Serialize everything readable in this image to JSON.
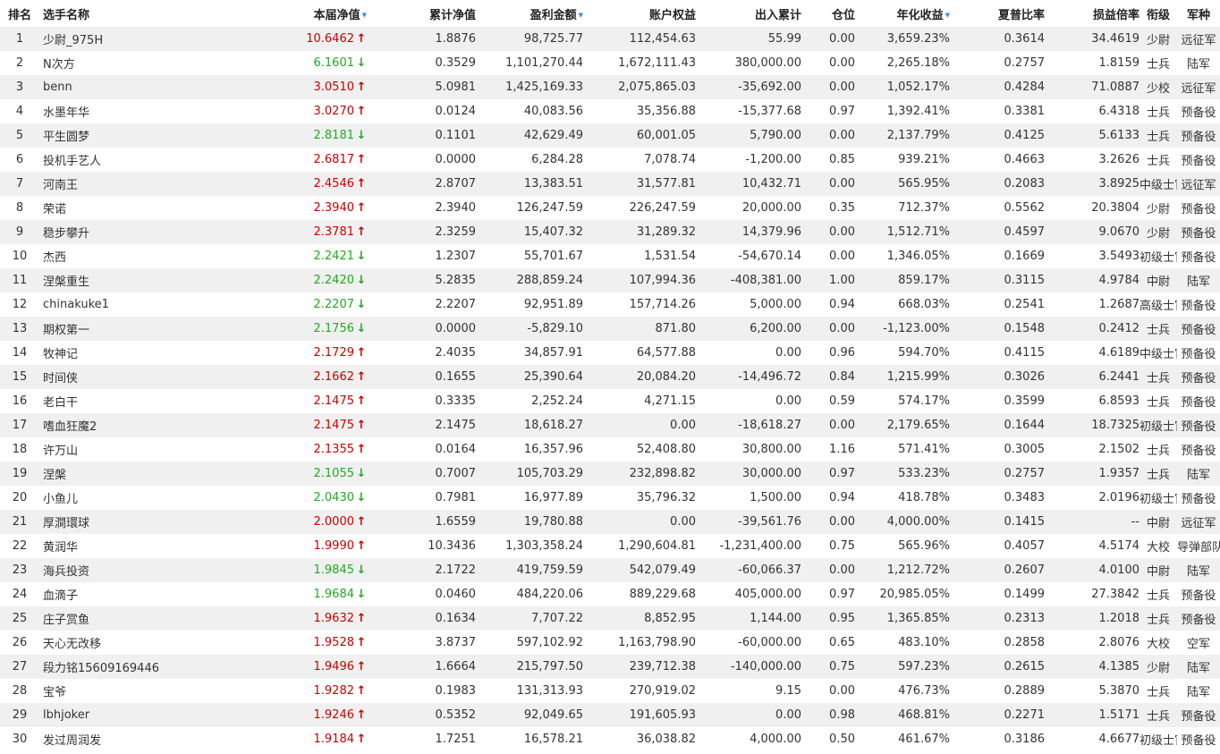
{
  "colors": {
    "up": "#cc0000",
    "down": "#22aa22",
    "sort_indicator": "#3a8fd6",
    "stripe": "#f0f0f0"
  },
  "headers": {
    "rank": "排名",
    "name": "选手名称",
    "nav": "本届净值",
    "cum_nav": "累计净值",
    "profit": "盈利金额",
    "equity": "账户权益",
    "flow": "出入累计",
    "position": "仓位",
    "annual": "年化收益",
    "sharpe": "夏普比率",
    "pl_ratio": "损益倍率",
    "rank_title": "衔级",
    "branch": "军种"
  },
  "rows": [
    {
      "rank": "1",
      "name": "少尉_975H",
      "nav": "10.6462",
      "dir": "up",
      "cum_nav": "1.8876",
      "profit": "98,725.77",
      "equity": "112,454.63",
      "flow": "55.99",
      "position": "0.00",
      "annual": "3,659.23%",
      "sharpe": "0.3614",
      "pl_ratio": "34.4619",
      "rank_title": "少尉",
      "branch": "远征军"
    },
    {
      "rank": "2",
      "name": "N次方",
      "nav": "6.1601",
      "dir": "down",
      "cum_nav": "0.3529",
      "profit": "1,101,270.44",
      "equity": "1,672,111.43",
      "flow": "380,000.00",
      "position": "0.00",
      "annual": "2,265.18%",
      "sharpe": "0.2757",
      "pl_ratio": "1.8159",
      "rank_title": "士兵",
      "branch": "陆军"
    },
    {
      "rank": "3",
      "name": "benn",
      "nav": "3.0510",
      "dir": "up",
      "cum_nav": "5.0981",
      "profit": "1,425,169.33",
      "equity": "2,075,865.03",
      "flow": "-35,692.00",
      "position": "0.00",
      "annual": "1,052.17%",
      "sharpe": "0.4284",
      "pl_ratio": "71.0887",
      "rank_title": "少校",
      "branch": "远征军"
    },
    {
      "rank": "4",
      "name": "水墨年华",
      "nav": "3.0270",
      "dir": "up",
      "cum_nav": "0.0124",
      "profit": "40,083.56",
      "equity": "35,356.88",
      "flow": "-15,377.68",
      "position": "0.97",
      "annual": "1,392.41%",
      "sharpe": "0.3381",
      "pl_ratio": "6.4318",
      "rank_title": "士兵",
      "branch": "预备役"
    },
    {
      "rank": "5",
      "name": "平生圆梦",
      "nav": "2.8181",
      "dir": "down",
      "cum_nav": "0.1101",
      "profit": "42,629.49",
      "equity": "60,001.05",
      "flow": "5,790.00",
      "position": "0.00",
      "annual": "2,137.79%",
      "sharpe": "0.4125",
      "pl_ratio": "5.6133",
      "rank_title": "士兵",
      "branch": "预备役"
    },
    {
      "rank": "6",
      "name": "投机手艺人",
      "nav": "2.6817",
      "dir": "up",
      "cum_nav": "0.0000",
      "profit": "6,284.28",
      "equity": "7,078.74",
      "flow": "-1,200.00",
      "position": "0.85",
      "annual": "939.21%",
      "sharpe": "0.4663",
      "pl_ratio": "3.2626",
      "rank_title": "士兵",
      "branch": "预备役"
    },
    {
      "rank": "7",
      "name": "河南王",
      "nav": "2.4546",
      "dir": "up",
      "cum_nav": "2.8707",
      "profit": "13,383.51",
      "equity": "31,577.81",
      "flow": "10,432.71",
      "position": "0.00",
      "annual": "565.95%",
      "sharpe": "0.2083",
      "pl_ratio": "3.8925",
      "rank_title": "中级士官",
      "branch": "远征军"
    },
    {
      "rank": "8",
      "name": "荣诺",
      "nav": "2.3940",
      "dir": "up",
      "cum_nav": "2.3940",
      "profit": "126,247.59",
      "equity": "226,247.59",
      "flow": "20,000.00",
      "position": "0.35",
      "annual": "712.37%",
      "sharpe": "0.5562",
      "pl_ratio": "20.3804",
      "rank_title": "少尉",
      "branch": "预备役"
    },
    {
      "rank": "9",
      "name": "稳步攀升",
      "nav": "2.3781",
      "dir": "up",
      "cum_nav": "2.3259",
      "profit": "15,407.32",
      "equity": "31,289.32",
      "flow": "14,379.96",
      "position": "0.00",
      "annual": "1,512.71%",
      "sharpe": "0.4597",
      "pl_ratio": "9.0670",
      "rank_title": "少尉",
      "branch": "预备役"
    },
    {
      "rank": "10",
      "name": "杰西",
      "nav": "2.2421",
      "dir": "down",
      "cum_nav": "1.2307",
      "profit": "55,701.67",
      "equity": "1,531.54",
      "flow": "-54,670.14",
      "position": "0.00",
      "annual": "1,346.05%",
      "sharpe": "0.1669",
      "pl_ratio": "3.5493",
      "rank_title": "初级士官",
      "branch": "预备役"
    },
    {
      "rank": "11",
      "name": "涅槃重生",
      "nav": "2.2420",
      "dir": "down",
      "cum_nav": "5.2835",
      "profit": "288,859.24",
      "equity": "107,994.36",
      "flow": "-408,381.00",
      "position": "1.00",
      "annual": "859.17%",
      "sharpe": "0.3115",
      "pl_ratio": "4.9784",
      "rank_title": "中尉",
      "branch": "陆军"
    },
    {
      "rank": "12",
      "name": "chinakuke1",
      "nav": "2.2207",
      "dir": "down",
      "cum_nav": "2.2207",
      "profit": "92,951.89",
      "equity": "157,714.26",
      "flow": "5,000.00",
      "position": "0.94",
      "annual": "668.03%",
      "sharpe": "0.2541",
      "pl_ratio": "1.2687",
      "rank_title": "高级士官",
      "branch": "预备役"
    },
    {
      "rank": "13",
      "name": "期权第一",
      "nav": "2.1756",
      "dir": "down",
      "cum_nav": "0.0000",
      "profit": "-5,829.10",
      "equity": "871.80",
      "flow": "6,200.00",
      "position": "0.00",
      "annual": "-1,123.00%",
      "sharpe": "0.1548",
      "pl_ratio": "0.2412",
      "rank_title": "士兵",
      "branch": "预备役"
    },
    {
      "rank": "14",
      "name": "牧神记",
      "nav": "2.1729",
      "dir": "up",
      "cum_nav": "2.4035",
      "profit": "34,857.91",
      "equity": "64,577.88",
      "flow": "0.00",
      "position": "0.96",
      "annual": "594.70%",
      "sharpe": "0.4115",
      "pl_ratio": "4.6189",
      "rank_title": "中级士官",
      "branch": "预备役"
    },
    {
      "rank": "15",
      "name": "时间侠",
      "nav": "2.1662",
      "dir": "up",
      "cum_nav": "0.1655",
      "profit": "25,390.64",
      "equity": "20,084.20",
      "flow": "-14,496.72",
      "position": "0.84",
      "annual": "1,215.99%",
      "sharpe": "0.3026",
      "pl_ratio": "6.2441",
      "rank_title": "士兵",
      "branch": "预备役"
    },
    {
      "rank": "16",
      "name": "老白干",
      "nav": "2.1475",
      "dir": "up",
      "cum_nav": "0.3335",
      "profit": "2,252.24",
      "equity": "4,271.15",
      "flow": "0.00",
      "position": "0.59",
      "annual": "574.17%",
      "sharpe": "0.3599",
      "pl_ratio": "6.8593",
      "rank_title": "士兵",
      "branch": "预备役"
    },
    {
      "rank": "17",
      "name": "嗜血狂魔2",
      "nav": "2.1475",
      "dir": "up",
      "cum_nav": "2.1475",
      "profit": "18,618.27",
      "equity": "0.00",
      "flow": "-18,618.27",
      "position": "0.00",
      "annual": "2,179.65%",
      "sharpe": "0.1644",
      "pl_ratio": "18.7325",
      "rank_title": "初级士官",
      "branch": "预备役"
    },
    {
      "rank": "18",
      "name": "许万山",
      "nav": "2.1355",
      "dir": "up",
      "cum_nav": "0.0164",
      "profit": "16,357.96",
      "equity": "52,408.80",
      "flow": "30,800.00",
      "position": "1.16",
      "annual": "571.41%",
      "sharpe": "0.3005",
      "pl_ratio": "2.1502",
      "rank_title": "士兵",
      "branch": "预备役"
    },
    {
      "rank": "19",
      "name": "涅槃",
      "nav": "2.1055",
      "dir": "down",
      "cum_nav": "0.7007",
      "profit": "105,703.29",
      "equity": "232,898.82",
      "flow": "30,000.00",
      "position": "0.97",
      "annual": "533.23%",
      "sharpe": "0.2757",
      "pl_ratio": "1.9357",
      "rank_title": "士兵",
      "branch": "陆军"
    },
    {
      "rank": "20",
      "name": "小鱼儿",
      "nav": "2.0430",
      "dir": "down",
      "cum_nav": "0.7981",
      "profit": "16,977.89",
      "equity": "35,796.32",
      "flow": "1,500.00",
      "position": "0.94",
      "annual": "418.78%",
      "sharpe": "0.3483",
      "pl_ratio": "2.0196",
      "rank_title": "初级士官",
      "branch": "预备役"
    },
    {
      "rank": "21",
      "name": "厚澗環球",
      "nav": "2.0000",
      "dir": "up",
      "cum_nav": "1.6559",
      "profit": "19,780.88",
      "equity": "0.00",
      "flow": "-39,561.76",
      "position": "0.00",
      "annual": "4,000.00%",
      "sharpe": "0.1415",
      "pl_ratio": "--",
      "rank_title": "中尉",
      "branch": "远征军"
    },
    {
      "rank": "22",
      "name": "黄润华",
      "nav": "1.9990",
      "dir": "up",
      "cum_nav": "10.3436",
      "profit": "1,303,358.24",
      "equity": "1,290,604.81",
      "flow": "-1,231,400.00",
      "position": "0.75",
      "annual": "565.96%",
      "sharpe": "0.4057",
      "pl_ratio": "4.5174",
      "rank_title": "大校",
      "branch": "导弹部队"
    },
    {
      "rank": "23",
      "name": "海兵投资",
      "nav": "1.9845",
      "dir": "down",
      "cum_nav": "2.1722",
      "profit": "419,759.59",
      "equity": "542,079.49",
      "flow": "-60,066.37",
      "position": "0.00",
      "annual": "1,212.72%",
      "sharpe": "0.2607",
      "pl_ratio": "4.0100",
      "rank_title": "中尉",
      "branch": "陆军"
    },
    {
      "rank": "24",
      "name": "血滴子",
      "nav": "1.9684",
      "dir": "down",
      "cum_nav": "0.0460",
      "profit": "484,220.06",
      "equity": "889,229.68",
      "flow": "405,000.00",
      "position": "0.97",
      "annual": "20,985.05%",
      "sharpe": "0.1499",
      "pl_ratio": "27.3842",
      "rank_title": "士兵",
      "branch": "预备役"
    },
    {
      "rank": "25",
      "name": "庄子赏鱼",
      "nav": "1.9632",
      "dir": "up",
      "cum_nav": "0.1634",
      "profit": "7,707.22",
      "equity": "8,852.95",
      "flow": "1,144.00",
      "position": "0.95",
      "annual": "1,365.85%",
      "sharpe": "0.2313",
      "pl_ratio": "1.2018",
      "rank_title": "士兵",
      "branch": "预备役"
    },
    {
      "rank": "26",
      "name": "天心无改移",
      "nav": "1.9528",
      "dir": "up",
      "cum_nav": "3.8737",
      "profit": "597,102.92",
      "equity": "1,163,798.90",
      "flow": "-60,000.00",
      "position": "0.65",
      "annual": "483.10%",
      "sharpe": "0.2858",
      "pl_ratio": "2.8076",
      "rank_title": "大校",
      "branch": "空军"
    },
    {
      "rank": "27",
      "name": "段力铭15609169446",
      "nav": "1.9496",
      "dir": "up",
      "cum_nav": "1.6664",
      "profit": "215,797.50",
      "equity": "239,712.38",
      "flow": "-140,000.00",
      "position": "0.75",
      "annual": "597.23%",
      "sharpe": "0.2615",
      "pl_ratio": "4.1385",
      "rank_title": "少尉",
      "branch": "陆军"
    },
    {
      "rank": "28",
      "name": "宝爷",
      "nav": "1.9282",
      "dir": "up",
      "cum_nav": "0.1983",
      "profit": "131,313.93",
      "equity": "270,919.02",
      "flow": "9.15",
      "position": "0.00",
      "annual": "476.73%",
      "sharpe": "0.2889",
      "pl_ratio": "5.3870",
      "rank_title": "士兵",
      "branch": "陆军"
    },
    {
      "rank": "29",
      "name": "lbhjoker",
      "nav": "1.9246",
      "dir": "up",
      "cum_nav": "0.5352",
      "profit": "92,049.65",
      "equity": "191,605.93",
      "flow": "0.00",
      "position": "0.98",
      "annual": "468.81%",
      "sharpe": "0.2271",
      "pl_ratio": "1.5171",
      "rank_title": "士兵",
      "branch": "预备役"
    },
    {
      "rank": "30",
      "name": "发过周润发",
      "nav": "1.9184",
      "dir": "up",
      "cum_nav": "1.7251",
      "profit": "16,578.21",
      "equity": "36,038.82",
      "flow": "4,000.00",
      "position": "0.50",
      "annual": "461.67%",
      "sharpe": "0.3186",
      "pl_ratio": "4.6677",
      "rank_title": "初级士官",
      "branch": "预备役"
    }
  ]
}
